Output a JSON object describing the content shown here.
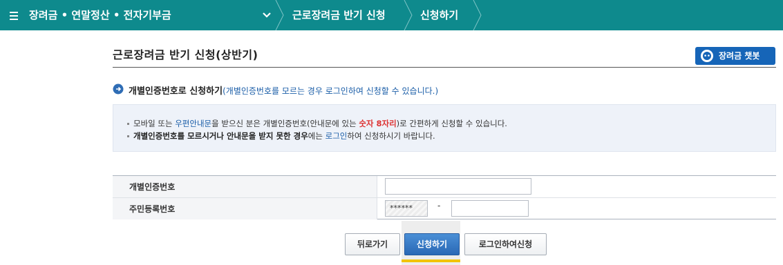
{
  "breadcrumb": {
    "menu": "장려금 • 연말정산 • 전자기부금",
    "item2": "근로장려금 반기 신청",
    "item3": "신청하기"
  },
  "page": {
    "title": "근로장려금 반기 신청(상반기)",
    "chatbot_label": "장려금 챗봇"
  },
  "section": {
    "heading": "개별인증번호로 신청하기",
    "subtext": "(개별인증번호를 모르는 경우 로그인하여 신청할 수 있습니다.)"
  },
  "info": {
    "line1": {
      "prefix": "모바일 또는 ",
      "link": "우편안내문",
      "middle": "을 받으신 분은 개별인증번호(안내문에 있는 ",
      "highlight": "숫자 8자리",
      "suffix": ")로 간편하게 신청할 수 있습니다."
    },
    "line2": {
      "bold": "개별인증번호를 모르시거나 안내문을 받지 못한 경우",
      "middle": "에는 ",
      "link": "로그인",
      "suffix": "하여 신청하시기 바랍니다."
    }
  },
  "form": {
    "auth_label": "개별인증번호",
    "auth_value": "",
    "rrn_label": "주민등록번호",
    "rrn_front": "******",
    "rrn_dash": "-",
    "rrn_back": ""
  },
  "buttons": {
    "back": "뒤로가기",
    "apply": "신청하기",
    "login_apply": "로그인하여신청"
  },
  "colors": {
    "topbar": "#0e8a8d",
    "primary_button": "#2a68b5",
    "focus_indicator": "#f2c400"
  }
}
